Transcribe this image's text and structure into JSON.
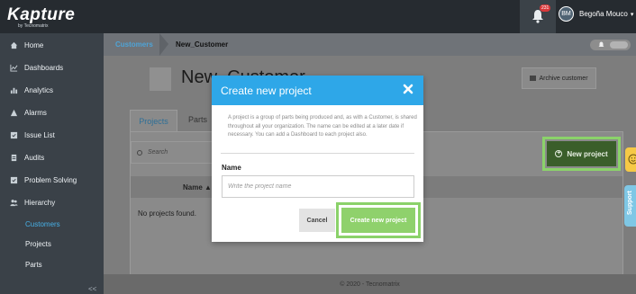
{
  "app": {
    "logo_text": "Kapture",
    "logo_subtext": "by Tecnomatrix"
  },
  "topbar": {
    "notification_count": "231",
    "user_initials": "BM",
    "user_name": "Begoña Mouco"
  },
  "sidebar": {
    "items": [
      {
        "label": "Home",
        "icon": "home-icon"
      },
      {
        "label": "Dashboards",
        "icon": "chart-icon"
      },
      {
        "label": "Analytics",
        "icon": "bar-chart-icon"
      },
      {
        "label": "Alarms",
        "icon": "warning-icon"
      },
      {
        "label": "Issue List",
        "icon": "checkbox-icon"
      },
      {
        "label": "Audits",
        "icon": "document-icon"
      },
      {
        "label": "Problem Solving",
        "icon": "checkbox-icon"
      },
      {
        "label": "Hierarchy",
        "icon": "users-icon"
      }
    ],
    "subitems": [
      {
        "label": "Customers",
        "active": true
      },
      {
        "label": "Projects",
        "active": false
      },
      {
        "label": "Parts",
        "active": false
      }
    ],
    "collapse_label": "<<"
  },
  "breadcrumb": {
    "parent": "Customers",
    "current": "New_Customer"
  },
  "page": {
    "title": "New_Customer",
    "archive_button": "Archive customer",
    "tabs": [
      {
        "label": "Projects",
        "active": true
      },
      {
        "label": "Parts",
        "active": false
      }
    ],
    "search_placeholder": "Search",
    "new_project_button": "New project",
    "table_headers": [
      "Name ▲"
    ],
    "empty_message": "No projects found."
  },
  "footer": {
    "text": "© 2020 - Tecnomatrix"
  },
  "side_widgets": {
    "support_label": "Support"
  },
  "modal": {
    "title": "Create new project",
    "description": "A project is a group of parts being produced and, as with a Customer, is shared throughout all your organization. The name can be edited at a later date if necessary. You can add a Dashboard to each project also.",
    "name_label": "Name",
    "name_placeholder": "Write the project name",
    "cancel_button": "Cancel",
    "create_button": "Create new project"
  },
  "colors": {
    "header_blue": "#2ea7e8",
    "create_green": "#8fd16c",
    "highlight_green": "#8bd26a",
    "sidebar_dark": "#3a4148",
    "topbar_dark": "#262b30",
    "active_link": "#47b0e6"
  }
}
